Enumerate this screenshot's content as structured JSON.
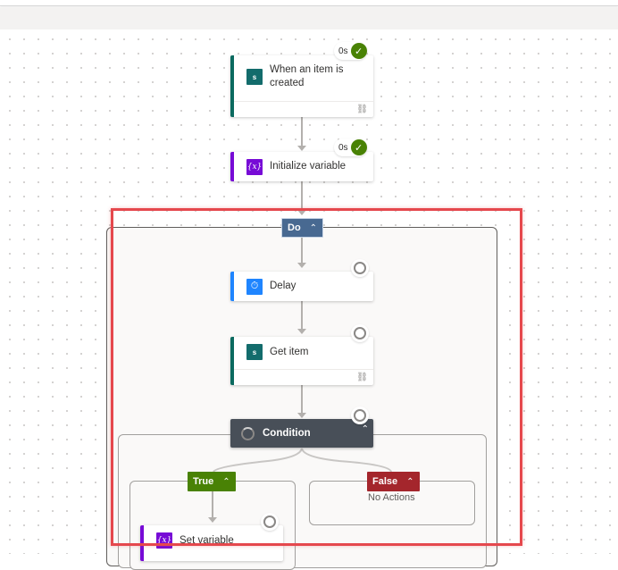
{
  "flow": {
    "trigger": {
      "title": "When an item is created",
      "icon": "sharepoint-icon",
      "status_duration": "0s",
      "status": "succeeded"
    },
    "init_variable": {
      "title": "Initialize variable",
      "icon": "variable-icon",
      "status_duration": "0s",
      "status": "succeeded"
    },
    "do_scope": {
      "label": "Do",
      "collapse_icon": "chevron-up-icon"
    },
    "delay": {
      "title": "Delay",
      "icon": "timer-icon",
      "status": "pending"
    },
    "get_item": {
      "title": "Get item",
      "icon": "sharepoint-icon",
      "status": "pending"
    },
    "condition": {
      "title": "Condition",
      "icon": "spinner-icon",
      "status": "pending",
      "collapse_icon": "chevron-up-icon"
    },
    "true_branch": {
      "label": "True",
      "collapse_icon": "chevron-up-icon"
    },
    "false_branch": {
      "label": "False",
      "collapse_icon": "chevron-up-icon",
      "empty_text": "No Actions"
    },
    "set_variable": {
      "title": "Set variable",
      "icon": "variable-icon",
      "status": "pending"
    }
  },
  "glyphs": {
    "check": "✓",
    "chevron_up": "⌃",
    "sharepoint": "s",
    "variable": "{x}",
    "timer": "⏱",
    "link": "⛓"
  },
  "colors": {
    "sharepoint": "#136c6c",
    "variable": "#770bd6",
    "delay": "#1f85ff",
    "success": "#498205",
    "do_pill": "#486991",
    "true_pill": "#498205",
    "false_pill": "#a4262c",
    "condition": "#484f58",
    "highlight": "#e5484d"
  }
}
